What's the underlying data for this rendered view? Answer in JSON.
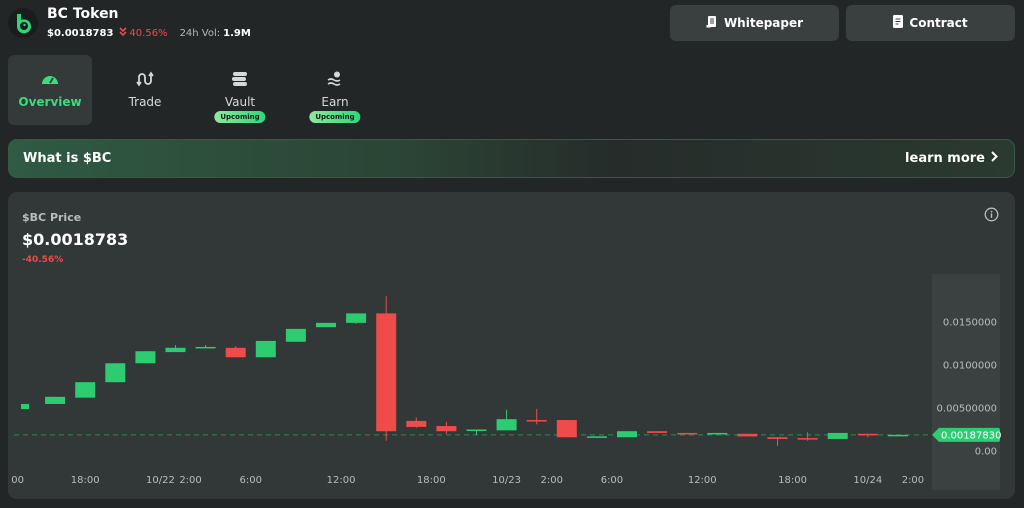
{
  "header": {
    "token_name": "BC Token",
    "price": "$0.0018783",
    "change": "40.56%",
    "change_direction": "down",
    "vol_label": "24h Vol:",
    "vol_value": "1.9M",
    "buttons": [
      {
        "label": "Whitepaper",
        "icon": "scroll-icon"
      },
      {
        "label": "Contract",
        "icon": "document-icon"
      }
    ]
  },
  "tabs": [
    {
      "label": "Overview",
      "icon": "gauge-icon",
      "active": true,
      "badge": null
    },
    {
      "label": "Trade",
      "icon": "swap-arrows-icon",
      "active": false,
      "badge": null
    },
    {
      "label": "Vault",
      "icon": "coin-stack-icon",
      "active": false,
      "badge": "Upcoming"
    },
    {
      "label": "Earn",
      "icon": "sun-waves-icon",
      "active": false,
      "badge": "Upcoming"
    }
  ],
  "banner": {
    "title": "What is $BC",
    "link": "learn more"
  },
  "price_card": {
    "label": "$BC Price",
    "price": "$0.0018783",
    "change": "-40.56%"
  },
  "colors": {
    "up": "#2ecc71",
    "down": "#f04b4b",
    "accent": "#3bdc7c",
    "last_price_line": "#2c8a52"
  },
  "chart_data": {
    "type": "candlestick",
    "title": "$BC Price",
    "ylim": [
      0,
      0.0175
    ],
    "y_ticks": [
      {
        "value": 0.015,
        "label": "0.0150000"
      },
      {
        "value": 0.01,
        "label": "0.0100000"
      },
      {
        "value": 0.005,
        "label": "0.00500000"
      },
      {
        "value": 0,
        "label": "0.00"
      }
    ],
    "x_ticks": [
      {
        "index": -0.5,
        "label": "00"
      },
      {
        "index": 2,
        "label": "18:00"
      },
      {
        "index": 4.5,
        "label": "10/22"
      },
      {
        "index": 5.5,
        "label": "2:00"
      },
      {
        "index": 7.5,
        "label": "6:00"
      },
      {
        "index": 10.5,
        "label": "12:00"
      },
      {
        "index": 13.5,
        "label": "18:00"
      },
      {
        "index": 16,
        "label": "10/23"
      },
      {
        "index": 17.5,
        "label": "2:00"
      },
      {
        "index": 19.5,
        "label": "6:00"
      },
      {
        "index": 22.5,
        "label": "12:00"
      },
      {
        "index": 25.5,
        "label": "18:00"
      },
      {
        "index": 28,
        "label": "10/24"
      },
      {
        "index": 29.5,
        "label": "2:00"
      }
    ],
    "last_price": 0.0018783,
    "last_price_label": "0.00187830",
    "candles": [
      {
        "o": 0.00488,
        "h": 0.00547,
        "l": 0.00488,
        "c": 0.00547
      },
      {
        "o": 0.00547,
        "h": 0.0063,
        "l": 0.00547,
        "c": 0.0063
      },
      {
        "o": 0.0062,
        "h": 0.008,
        "l": 0.0062,
        "c": 0.008
      },
      {
        "o": 0.008,
        "h": 0.0102,
        "l": 0.008,
        "c": 0.0102
      },
      {
        "o": 0.0102,
        "h": 0.0116,
        "l": 0.0102,
        "c": 0.0116
      },
      {
        "o": 0.0115,
        "h": 0.0123,
        "l": 0.0115,
        "c": 0.012
      },
      {
        "o": 0.012,
        "h": 0.0123,
        "l": 0.012,
        "c": 0.0121
      },
      {
        "o": 0.012,
        "h": 0.0122,
        "l": 0.0109,
        "c": 0.0109
      },
      {
        "o": 0.0109,
        "h": 0.0128,
        "l": 0.0109,
        "c": 0.0128
      },
      {
        "o": 0.0127,
        "h": 0.0142,
        "l": 0.0127,
        "c": 0.0142
      },
      {
        "o": 0.0144,
        "h": 0.0149,
        "l": 0.0144,
        "c": 0.0149
      },
      {
        "o": 0.0149,
        "h": 0.016,
        "l": 0.0148,
        "c": 0.016
      },
      {
        "o": 0.016,
        "h": 0.018,
        "l": 0.0012,
        "c": 0.0023
      },
      {
        "o": 0.0035,
        "h": 0.0039,
        "l": 0.0027,
        "c": 0.0028
      },
      {
        "o": 0.0029,
        "h": 0.0034,
        "l": 0.002,
        "c": 0.0023
      },
      {
        "o": 0.0024,
        "h": 0.0025,
        "l": 0.0019,
        "c": 0.0025
      },
      {
        "o": 0.0024,
        "h": 0.0048,
        "l": 0.0024,
        "c": 0.0037
      },
      {
        "o": 0.0036,
        "h": 0.0049,
        "l": 0.0031,
        "c": 0.0035
      },
      {
        "o": 0.0036,
        "h": 0.0036,
        "l": 0.0016,
        "c": 0.0016
      },
      {
        "o": 0.0016,
        "h": 0.0017,
        "l": 0.0015,
        "c": 0.0017
      },
      {
        "o": 0.0016,
        "h": 0.0023,
        "l": 0.0016,
        "c": 0.0023
      },
      {
        "o": 0.0023,
        "h": 0.0023,
        "l": 0.0021,
        "c": 0.0021
      },
      {
        "o": 0.0021,
        "h": 0.0021,
        "l": 0.002,
        "c": 0.002
      },
      {
        "o": 0.002,
        "h": 0.0021,
        "l": 0.002,
        "c": 0.0021
      },
      {
        "o": 0.002,
        "h": 0.002,
        "l": 0.0017,
        "c": 0.0017
      },
      {
        "o": 0.0016,
        "h": 0.0016,
        "l": 0.0006,
        "c": 0.0014
      },
      {
        "o": 0.0015,
        "h": 0.0022,
        "l": 0.0012,
        "c": 0.0014
      },
      {
        "o": 0.0014,
        "h": 0.0021,
        "l": 0.0014,
        "c": 0.0021
      },
      {
        "o": 0.002,
        "h": 0.002,
        "l": 0.0016,
        "c": 0.0019
      },
      {
        "o": 0.00185,
        "h": 0.0019,
        "l": 0.00185,
        "c": 0.0018783
      }
    ]
  }
}
